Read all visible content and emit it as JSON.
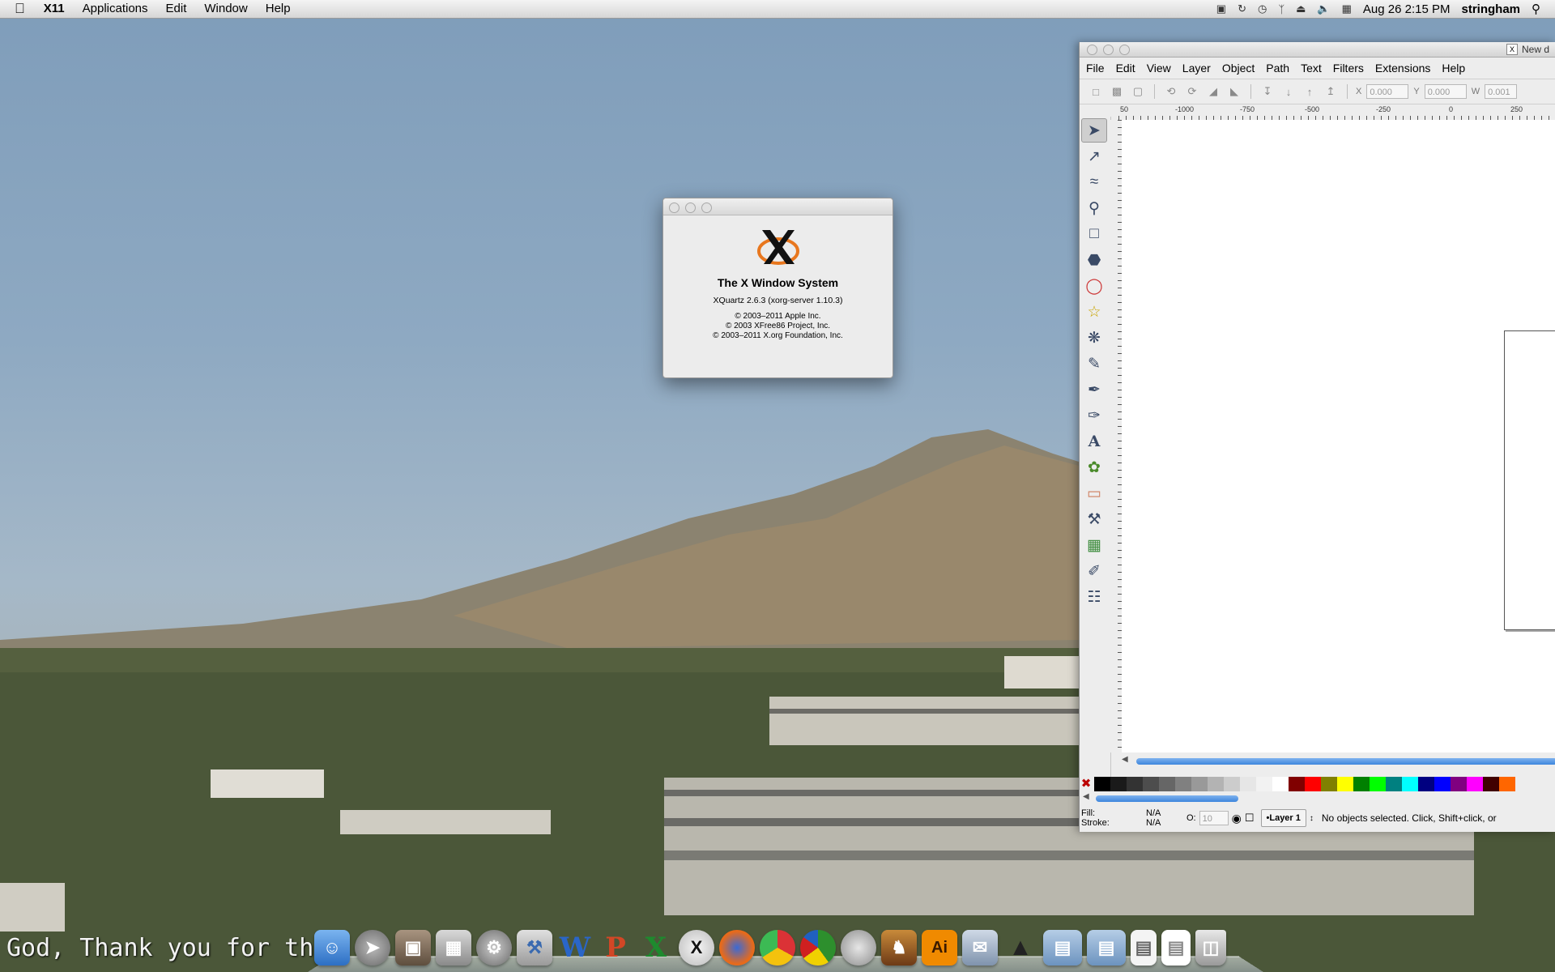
{
  "menubar": {
    "app_name": "X11",
    "items": [
      "Applications",
      "Edit",
      "Window",
      "Help"
    ],
    "clock": "Aug 26  2:15 PM",
    "user": "stringham"
  },
  "about": {
    "title": "The X Window System",
    "version": "XQuartz 2.6.3 (xorg-server 1.10.3)",
    "copyright": [
      "© 2003–2011 Apple Inc.",
      "© 2003 XFree86 Project, Inc.",
      "© 2003–2011 X.org Foundation, Inc."
    ]
  },
  "inkscape": {
    "window_title": "New d",
    "menu": [
      "File",
      "Edit",
      "View",
      "Layer",
      "Object",
      "Path",
      "Text",
      "Filters",
      "Extensions",
      "Help"
    ],
    "fields": {
      "x_label": "X",
      "x_value": "0.000",
      "y_label": "Y",
      "y_value": "0.000",
      "w_label": "W",
      "w_value": "0.001"
    },
    "ruler_labels": [
      "50",
      "-1000",
      "-750",
      "-500",
      "-250",
      "0",
      "250"
    ],
    "status": {
      "fill_label": "Fill:",
      "fill_value": "N/A",
      "stroke_label": "Stroke:",
      "stroke_value": "N/A",
      "opacity_label": "O:",
      "opacity_value": "10",
      "layer": "•Layer 1",
      "message": "No objects selected. Click, Shift+click, or"
    },
    "palette": [
      "#000000",
      "#1a1a1a",
      "#333333",
      "#4d4d4d",
      "#666666",
      "#808080",
      "#999999",
      "#b3b3b3",
      "#cccccc",
      "#e6e6e6",
      "#f2f2f2",
      "#ffffff",
      "#800000",
      "#ff0000",
      "#808000",
      "#ffff00",
      "#008000",
      "#00ff00",
      "#008080",
      "#00ffff",
      "#000080",
      "#0000ff",
      "#800080",
      "#ff00ff",
      "#400000",
      "#ff6600"
    ]
  },
  "dock": {
    "items": [
      "finder-icon",
      "launchpad-icon",
      "image-capture-icon",
      "preview-icon",
      "system-preferences-icon",
      "utility-icon",
      "word-icon",
      "powerpoint-icon",
      "excel-icon",
      "xquartz-icon",
      "firefox-icon",
      "chrome-icon",
      "pie-chart-app-icon",
      "mail-stamp-icon",
      "inkscape-mascot-icon",
      "illustrator-icon",
      "mail-icon",
      "inkscape-icon",
      "applications-folder-icon",
      "documents-folder-icon",
      "file-icon",
      "document-icon",
      "trash-icon"
    ],
    "labels": {
      "word": "W",
      "powerpoint": "P",
      "excel": "X",
      "illustrator": "Ai"
    }
  },
  "caption": "God, Thank you for this"
}
